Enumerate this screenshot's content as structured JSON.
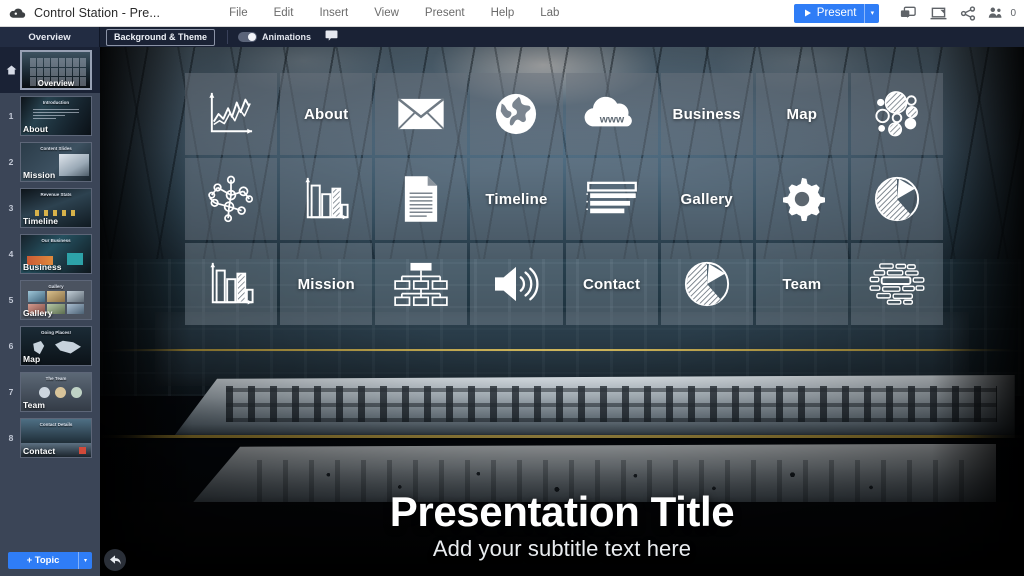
{
  "topbar": {
    "logo_icon": "cloud-icon",
    "doc_title": "Control Station - Pre...",
    "menu": [
      "File",
      "Edit",
      "Insert",
      "View",
      "Present",
      "Help",
      "Lab"
    ],
    "present_button": "Present",
    "present_caret": "▾",
    "icons": [
      "comment-icon",
      "present-on-device-icon",
      "share-icon",
      "people-icon"
    ],
    "people_count": "0"
  },
  "toolstrip": {
    "overview_tab": "Overview",
    "background_theme_button": "Background & Theme",
    "animations_label": "Animations",
    "animations_on": true,
    "comment_icon": "comment-icon"
  },
  "sidebar": {
    "current": {
      "num": "",
      "label": "Overview",
      "home_icon": "home-icon"
    },
    "slides": [
      {
        "num": "1",
        "label": "About",
        "thumb_title": "Introduction"
      },
      {
        "num": "2",
        "label": "Mission",
        "thumb_title": "Content Slides"
      },
      {
        "num": "3",
        "label": "Timeline",
        "thumb_title": "Revenue Stats"
      },
      {
        "num": "4",
        "label": "Business",
        "thumb_title": "Our Business"
      },
      {
        "num": "5",
        "label": "Gallery",
        "thumb_title": "Gallery"
      },
      {
        "num": "6",
        "label": "Map",
        "thumb_title": "Going Places!"
      },
      {
        "num": "7",
        "label": "Team",
        "thumb_title": "The Team"
      },
      {
        "num": "8",
        "label": "Contact",
        "thumb_title": "Contact Details"
      }
    ],
    "add_topic_button": "+ Topic",
    "add_topic_caret": "▾"
  },
  "slide": {
    "title": "Presentation Title",
    "subtitle": "Add your subtitle text here",
    "back_icon": "back-arrow-icon",
    "tiles": [
      {
        "type": "icon",
        "icon": "line-chart-icon",
        "label": ""
      },
      {
        "type": "label",
        "icon": "",
        "label": "About"
      },
      {
        "type": "icon",
        "icon": "envelope-icon",
        "label": ""
      },
      {
        "type": "icon",
        "icon": "globe-icon",
        "label": ""
      },
      {
        "type": "icon",
        "icon": "www-cloud-icon",
        "label": ""
      },
      {
        "type": "label",
        "icon": "",
        "label": "Business"
      },
      {
        "type": "label",
        "icon": "",
        "label": "Map"
      },
      {
        "type": "icon",
        "icon": "bubble-chart-icon",
        "label": ""
      },
      {
        "type": "icon",
        "icon": "network-nodes-icon",
        "label": ""
      },
      {
        "type": "icon",
        "icon": "bar-chart-icon",
        "label": ""
      },
      {
        "type": "icon",
        "icon": "document-icon",
        "label": ""
      },
      {
        "type": "label",
        "icon": "",
        "label": "Timeline"
      },
      {
        "type": "icon",
        "icon": "text-lines-icon",
        "label": ""
      },
      {
        "type": "label",
        "icon": "",
        "label": "Gallery"
      },
      {
        "type": "icon",
        "icon": "gear-icon",
        "label": ""
      },
      {
        "type": "icon",
        "icon": "pie-chart-icon",
        "label": ""
      },
      {
        "type": "icon",
        "icon": "bar-chart-icon",
        "label": ""
      },
      {
        "type": "label",
        "icon": "",
        "label": "Mission"
      },
      {
        "type": "icon",
        "icon": "org-chart-icon",
        "label": ""
      },
      {
        "type": "icon",
        "icon": "speaker-icon",
        "label": ""
      },
      {
        "type": "label",
        "icon": "",
        "label": "Contact"
      },
      {
        "type": "icon",
        "icon": "pie-chart-icon",
        "label": ""
      },
      {
        "type": "label",
        "icon": "",
        "label": "Team"
      },
      {
        "type": "icon",
        "icon": "word-cloud-icon",
        "label": ""
      }
    ]
  },
  "colors": {
    "accent_blue": "#2f7df6",
    "sidebar_bg": "#3b4557",
    "toolstrip_bg": "#1a2235",
    "topbar_bg": "#ffffff",
    "rail_gold": "#c9a63a"
  }
}
